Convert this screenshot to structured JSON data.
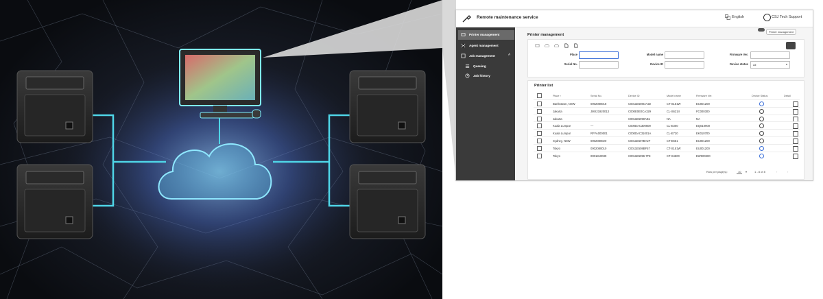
{
  "app": {
    "title": "Remote maintenance service",
    "language": "English",
    "user": "CSJ Tech Support",
    "toggle_label": "Printer management"
  },
  "sidebar": {
    "items": [
      {
        "label": "Printer management",
        "icon": "printer-icon",
        "active": true
      },
      {
        "label": "Agent management",
        "icon": "network-icon"
      },
      {
        "label": "Job management",
        "icon": "job-icon"
      },
      {
        "label": "Queuing",
        "icon": "queue-icon"
      },
      {
        "label": "Job history",
        "icon": "history-icon"
      }
    ]
  },
  "printer_management": {
    "title": "Printer management",
    "filters": {
      "place_label": "Place",
      "model_name_label": "Model name",
      "firmware_label": "Firmware Ver.",
      "serial_label": "Serial No.",
      "device_id_label": "Device ID",
      "device_status_label": "Device status",
      "device_status_value": "All"
    }
  },
  "printer_list": {
    "title": "Printer list",
    "columns": [
      "Place ↑",
      "Serial No.",
      "Device ID",
      "Model name",
      "Firmware Ver.",
      "Device Status",
      "Detail"
    ],
    "rows": [
      {
        "place": "Bankstown, NSW",
        "serial": "0002080018",
        "device_id": "C0011E508CA4D",
        "model": "CT-S151W",
        "firmware": "EU001200",
        "status": "ok"
      },
      {
        "place": "Jakarta",
        "serial": "JMX21920013",
        "device_id": "C000E0E0CA329",
        "model": "CL-S621II",
        "firmware": "FC000300",
        "status": "warn"
      },
      {
        "place": "Jakarta",
        "serial": "",
        "device_id": "C0011E5090AB1",
        "model": "NA",
        "firmware": "NA",
        "status": "warn"
      },
      {
        "place": "Kuala Lumpur",
        "serial": "—",
        "device_id": "C000DAC300609",
        "model": "CL-E300",
        "firmware": "EQ010900",
        "status": "warn"
      },
      {
        "place": "Kuala Lumpur",
        "serial": "RFFA000001",
        "device_id": "C000DAC31001A",
        "model": "CL-E720",
        "firmware": "EK010700",
        "status": "warn"
      },
      {
        "place": "Sydney, NSW",
        "serial": "0002080020",
        "device_id": "C0011E507BA2F",
        "model": "CT-E651",
        "firmware": "EU001200",
        "status": "warn"
      },
      {
        "place": "Tokyo",
        "serial": "0002080010",
        "device_id": "C0011E508BF57",
        "model": "CT-S151W",
        "firmware": "EU001200",
        "status": "ok"
      },
      {
        "place": "Tokyo",
        "serial": "0001810039",
        "device_id": "C0011E5096 7F8",
        "model": "CT-S4500",
        "firmware": "EW000200",
        "status": "ok"
      }
    ],
    "pager": {
      "rows_label": "Row per page(s):",
      "rows_value": "10",
      "range": "1 - 8 of 8"
    }
  },
  "colors": {
    "sidebar_bg": "#3a3a3a",
    "sidebar_active": "#6a6a6a",
    "accent": "#3b6fd8",
    "glow": "#4fd6e8"
  }
}
